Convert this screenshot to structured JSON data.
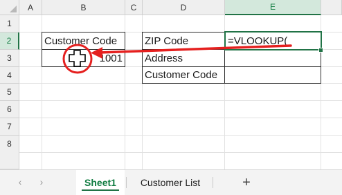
{
  "columns": [
    "A",
    "B",
    "C",
    "D",
    "E"
  ],
  "rows": [
    "1",
    "2",
    "3",
    "4",
    "5",
    "6",
    "7",
    "8"
  ],
  "selected_column": "E",
  "selected_row": "2",
  "cells": {
    "B2": "Customer Code",
    "B3": "1001",
    "D2": "ZIP Code",
    "D3": "Address",
    "D4": "Customer Code",
    "E2": "=VLOOKUP("
  },
  "annotation": {
    "color": "#e5201f",
    "description_icon": "white-cross-cursor-icon"
  },
  "tabs": {
    "prev_icon": "‹",
    "next_icon": "›",
    "items": [
      "Sheet1",
      "Customer List"
    ],
    "active_index": 0,
    "add_label": "+"
  },
  "colors": {
    "accent": "#217346",
    "header_bg": "#efefef",
    "selected_header_bg": "#d3e8dc"
  }
}
